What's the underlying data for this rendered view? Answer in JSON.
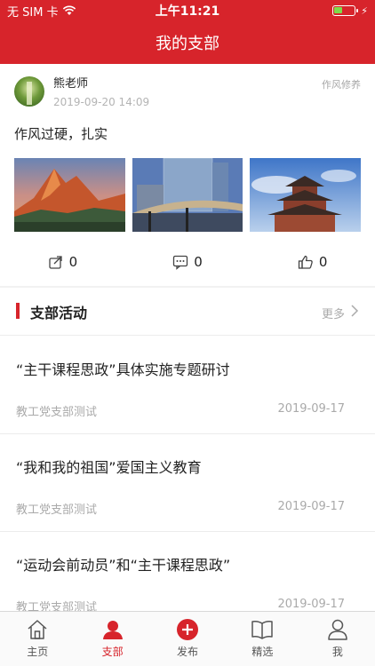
{
  "status_bar": {
    "carrier": "无 SIM 卡",
    "time": "上午11:21",
    "battery_level": 0.45,
    "battery_color": "#7ddc4a"
  },
  "header": {
    "title": "我的支部"
  },
  "post": {
    "author": "熊老师",
    "time": "2019-09-20 14:09",
    "category": "作风修养",
    "content": "作风过硬，扎实",
    "photos": [
      "mountain-photo",
      "building-photo",
      "pagoda-photo"
    ],
    "share_count": "0",
    "comment_count": "0",
    "like_count": "0"
  },
  "section": {
    "title": "支部活动",
    "more": "更多"
  },
  "activities": [
    {
      "title": "“主干课程思政”具体实施专题研讨",
      "org": "教工党支部测试",
      "date": "2019-09-17"
    },
    {
      "title": "“我和我的祖国”爱国主义教育",
      "org": "教工党支部测试",
      "date": "2019-09-17"
    },
    {
      "title": "“运动会前动员”和“主干课程思政”",
      "org": "教工党支部测试",
      "date": "2019-09-17"
    }
  ],
  "tabs": [
    {
      "label": "主页",
      "icon": "home-icon"
    },
    {
      "label": "支部",
      "icon": "person-icon",
      "active": true
    },
    {
      "label": "发布",
      "icon": "plus-circle-icon"
    },
    {
      "label": "精选",
      "icon": "book-icon"
    },
    {
      "label": "我",
      "icon": "user-icon"
    }
  ],
  "colors": {
    "brand": "#d7242b",
    "muted": "#aaaaaa"
  }
}
